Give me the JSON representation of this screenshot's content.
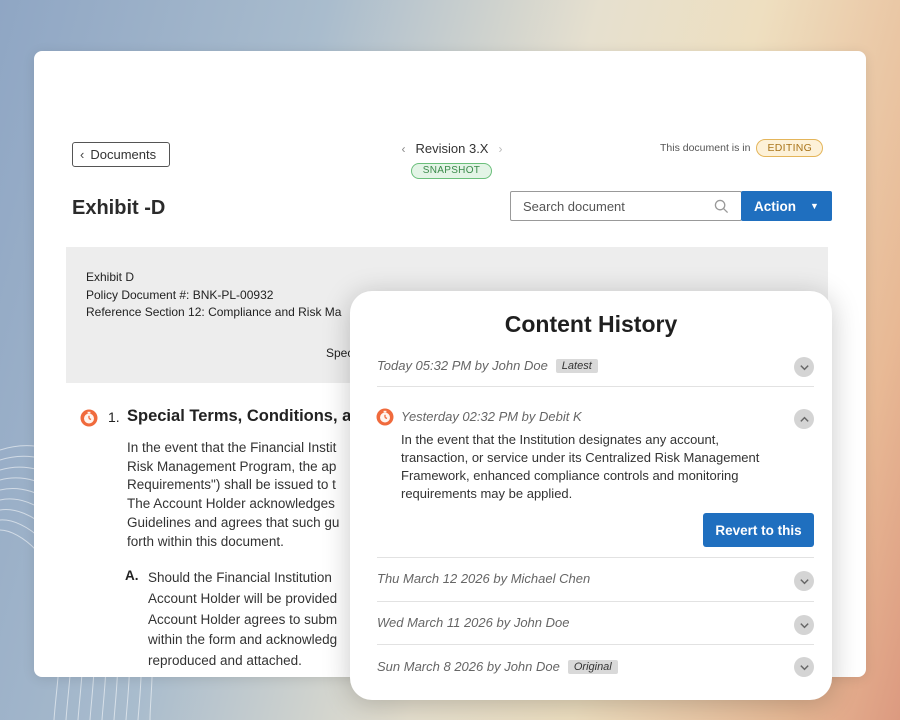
{
  "header": {
    "back_label": "Documents",
    "revision_label": "Revision 3.X",
    "snapshot_badge": "SNAPSHOT",
    "status_prefix": "This document is in",
    "status_badge": "EDITING",
    "title": "Exhibit -D",
    "search_placeholder": "Search document",
    "action_label": "Action"
  },
  "document": {
    "header_lines": [
      "Exhibit D",
      "Policy Document #: BNK-PL-00932",
      "Reference Section 12: Compliance and Risk Ma",
      "Spec"
    ],
    "section_number": "1.",
    "section_heading": "Special Terms, Conditions, an",
    "section_body": "In the event that the Financial Instit\nRisk Management Program, the ap\nRequirements\") shall be issued to t\nThe Account Holder acknowledges\nGuidelines and agrees that such gu\nforth within this document.",
    "subitem_label": "A.",
    "subitem_body": "Should the Financial Institution\nAccount Holder will be provided\nAccount Holder agrees to subm\nwithin the form and acknowledg\nreproduced and attached."
  },
  "history": {
    "title": "Content History",
    "entries": [
      {
        "meta": "Today 05:32 PM by John Doe",
        "tag": "Latest"
      },
      {
        "meta": "Yesterday 02:32 PM by Debit K",
        "content": "In the event that the Institution designates any account,\ntransaction, or service under its Centralized Risk Management\nFramework, enhanced compliance controls and monitoring\nrequirements may be applied.",
        "revert_label": "Revert to this"
      },
      {
        "meta": "Thu March 12 2026 by Michael Chen"
      },
      {
        "meta": "Wed March 11 2026 by John Doe"
      },
      {
        "meta": "Sun March 8 2026 by John Doe",
        "tag": "Original"
      }
    ]
  },
  "colors": {
    "accent_blue": "#1f6fbf",
    "editing_badge": "#e4b55a",
    "snapshot_badge": "#6bbf7b",
    "clock_icon": "#f06a3c"
  },
  "icons": [
    "chevron-left-icon",
    "chevron-right-icon",
    "search-icon",
    "caret-down-icon",
    "clock-icon",
    "chevron-up-icon",
    "chevron-down-icon"
  ]
}
